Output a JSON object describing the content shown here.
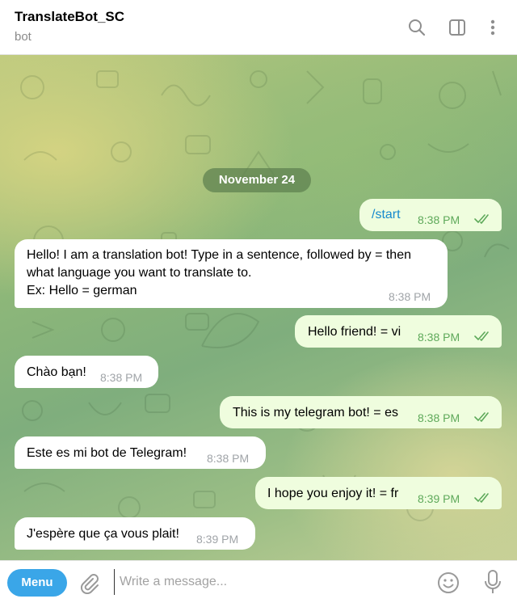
{
  "header": {
    "title": "TranslateBot_SC",
    "subtitle": "bot",
    "icons": [
      "search-icon",
      "sidebar-panel-icon",
      "more-vert-icon"
    ]
  },
  "chat": {
    "date_separator": "November 24",
    "messages": [
      {
        "direction": "out",
        "text": "/start",
        "time": "8:38 PM",
        "status": "read"
      },
      {
        "direction": "in",
        "lines": [
          "Hello! I am a translation bot! Type in a sentence, followed by = then",
          "what language you want to translate to.",
          "Ex: Hello = german"
        ],
        "time": "8:38 PM"
      },
      {
        "direction": "out",
        "text": "Hello friend! = vi",
        "time": "8:38 PM",
        "status": "read"
      },
      {
        "direction": "in",
        "text": "Chào bạn!",
        "time": "8:38 PM"
      },
      {
        "direction": "out",
        "text": "This is my telegram bot! = es",
        "time": "8:38 PM",
        "status": "read"
      },
      {
        "direction": "in",
        "text": "Este es mi bot de Telegram!",
        "time": "8:38 PM"
      },
      {
        "direction": "out",
        "text": "I hope you enjoy it! = fr",
        "time": "8:39 PM",
        "status": "read"
      },
      {
        "direction": "in",
        "text": "J'espère que ça vous plait!",
        "time": "8:39 PM"
      }
    ]
  },
  "composer": {
    "menu_label": "Menu",
    "placeholder": "Write a message...",
    "icons": [
      "paperclip-icon",
      "emoji-icon",
      "microphone-icon"
    ]
  },
  "colors": {
    "accent": "#3aa6e8",
    "outgoing_bubble": "#effdde",
    "incoming_bubble": "#ffffff",
    "read_check": "#5ea95a"
  }
}
